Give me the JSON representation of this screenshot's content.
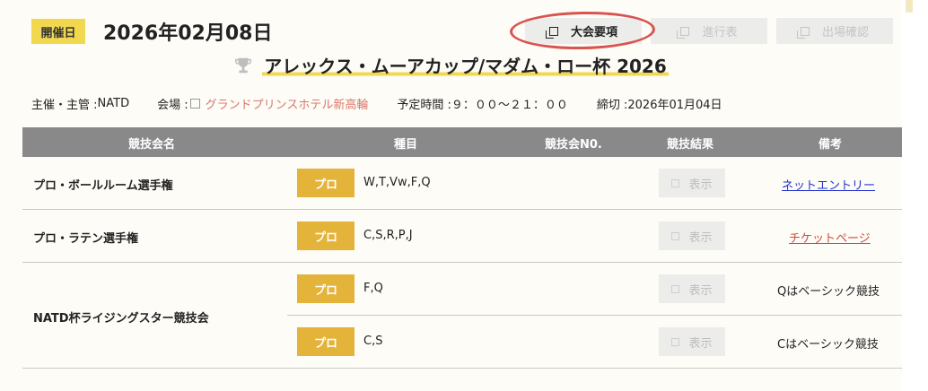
{
  "header": {
    "date_badge": "開催日",
    "date": "2026年02月08日",
    "buttons": [
      {
        "label": "大会要項",
        "enabled": true
      },
      {
        "label": "進行表",
        "enabled": false
      },
      {
        "label": "出場確認",
        "enabled": false
      }
    ]
  },
  "title": "アレックス・ムーアカップ/マダム・ロー杯 2026",
  "info": {
    "organizer_label": "主催・主管 : ",
    "organizer": "NATD",
    "venue_label": "会場 : ",
    "venue": "グランドプリンスホテル新高輪",
    "time_label": "予定時間 : ",
    "time": "９：００～２１：００",
    "deadline_label": "締切 : ",
    "deadline": "2026年01月04日"
  },
  "table": {
    "headers": [
      "競技会名",
      "種目",
      "競技会N0.",
      "競技結果",
      "備考"
    ],
    "rows": [
      {
        "name": "プロ・ボールルーム選手権",
        "category": "プロ",
        "events": "W,T,Vw,F,Q",
        "result": "表示",
        "remark": "ネットエントリー"
      },
      {
        "name": "プロ・ラテン選手権",
        "category": "プロ",
        "events": "C,S,R,P,J",
        "result": "表示",
        "remark": "チケットページ"
      },
      {
        "name": "NATD杯ライジングスター競技会",
        "category": "プロ",
        "events": "F,Q",
        "result": "表示",
        "remark": "Qはベーシック競技"
      },
      {
        "name": "",
        "category": "プロ",
        "events": "C,S",
        "result": "表示",
        "remark": "Cはベーシック競技"
      }
    ]
  },
  "colors": {
    "badge_yellow": "#f2d84f",
    "pro_button": "#e4b33a",
    "header_gray": "#898989",
    "annotation_circle": "#d9534f",
    "link_blue": "#2233cc",
    "link_red": "#d24a3c"
  }
}
